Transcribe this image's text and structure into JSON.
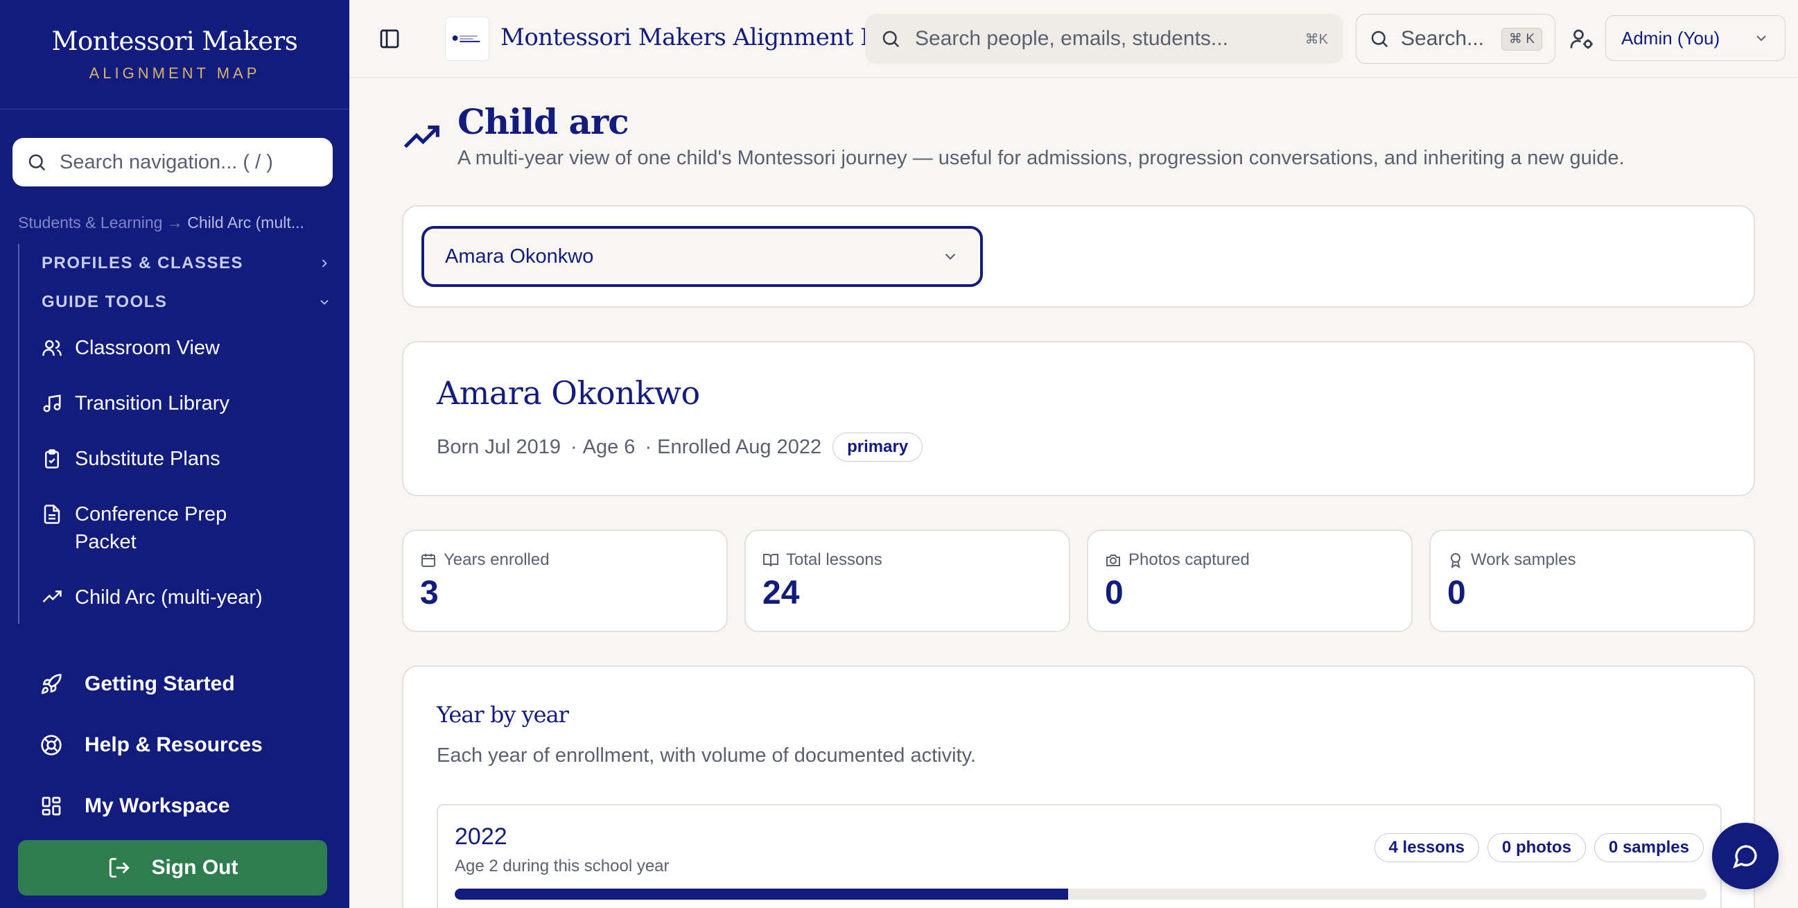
{
  "sidebar": {
    "brand_title": "Montessori Makers",
    "brand_subtitle": "ALIGNMENT MAP",
    "search_placeholder": "Search navigation... ( / )",
    "breadcrumb_parent": "Students & Learning",
    "breadcrumb_arrow": "→",
    "breadcrumb_current": "Child Arc (mult...",
    "group_profiles": "PROFILES & CLASSES",
    "group_guide_tools": "GUIDE TOOLS",
    "items": [
      {
        "label": "Classroom View",
        "icon": "users-icon"
      },
      {
        "label": "Transition Library",
        "icon": "music-icon"
      },
      {
        "label": "Substitute Plans",
        "icon": "clipboard-check-icon"
      },
      {
        "label": "Conference Prep Packet",
        "icon": "document-icon"
      },
      {
        "label": "Child Arc (multi-year)",
        "icon": "trending-up-icon"
      }
    ],
    "bottom": [
      {
        "label": "Getting Started",
        "icon": "rocket-icon"
      },
      {
        "label": "Help & Resources",
        "icon": "lifebuoy-icon"
      },
      {
        "label": "My Workspace",
        "icon": "grid-icon"
      }
    ],
    "sign_out": "Sign Out",
    "brand_color": "#121c7e",
    "sign_out_color": "#2e7d4f"
  },
  "topbar": {
    "title": "Montessori Makers Alignment Map",
    "search_placeholder": "Search people, emails, students...",
    "search_shortcut": "⌘K",
    "search2_placeholder": "Search...",
    "search2_shortcut": "⌘ K",
    "role": "Admin (You)"
  },
  "page": {
    "title": "Child arc",
    "description": "A multi-year view of one child's Montessori journey — useful for admissions, progression conversations, and inheriting a new guide.",
    "selected_child": "Amara Okonkwo"
  },
  "profile": {
    "name": "Amara Okonkwo",
    "born": "Born Jul 2019",
    "age": "Age 6",
    "enrolled": "Enrolled Aug 2022",
    "level_badge": "primary"
  },
  "stats": [
    {
      "label": "Years enrolled",
      "value": "3",
      "icon": "calendar-icon"
    },
    {
      "label": "Total lessons",
      "value": "24",
      "icon": "book-open-icon"
    },
    {
      "label": "Photos captured",
      "value": "0",
      "icon": "camera-icon"
    },
    {
      "label": "Work samples",
      "value": "0",
      "icon": "award-icon"
    }
  ],
  "year_by_year": {
    "title": "Year by year",
    "description": "Each year of enrollment, with volume of documented activity.",
    "years": [
      {
        "year": "2022",
        "subtitle": "Age 2 during this school year",
        "lessons": "4 lessons",
        "photos": "0 photos",
        "samples": "0 samples",
        "activity_fraction": 0.49
      }
    ]
  }
}
